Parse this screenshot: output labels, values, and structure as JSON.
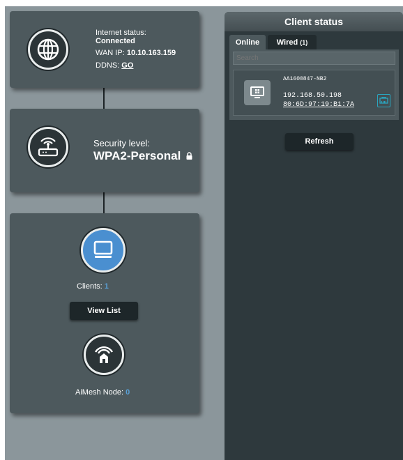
{
  "internet": {
    "status_label": "Internet status:",
    "status_value": "Connected",
    "wan_ip_label": "WAN IP:",
    "wan_ip_value": "10.10.163.159",
    "ddns_label": "DDNS:",
    "ddns_link": "GO"
  },
  "security": {
    "label": "Security level:",
    "value": "WPA2-Personal"
  },
  "clients": {
    "label": "Clients:",
    "count": "1",
    "view_list_button": "View List",
    "aimesh_label": "AiMesh Node:",
    "aimesh_count": "0"
  },
  "client_status": {
    "title": "Client status",
    "tabs": {
      "online": "Online",
      "wired": "Wired",
      "wired_count": "(1)"
    },
    "search_placeholder": "Search",
    "client": {
      "name": "AA1600847-NB2",
      "ip": "192.168.50.198",
      "mac": "80:6D:97:19:B1:7A"
    },
    "refresh_button": "Refresh"
  },
  "colors": {
    "accent_blue": "#5aa0d6",
    "panel": "#4d595d",
    "background": "#8b969b",
    "wired_icon": "#2aa6c0"
  }
}
